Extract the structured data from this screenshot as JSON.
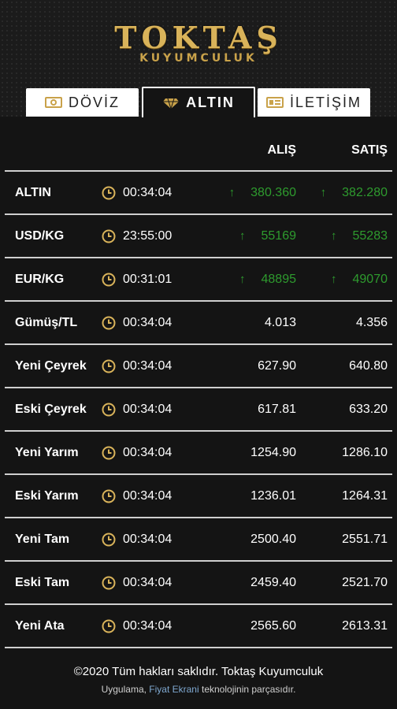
{
  "brand": {
    "name": "TOKTAŞ",
    "subtitle": "KUYUMCULUK"
  },
  "tabs": [
    {
      "label": "DÖVİZ",
      "icon": "money-icon",
      "active": false
    },
    {
      "label": "ALTIN",
      "icon": "diamond-icon",
      "active": true
    },
    {
      "label": "İLETİŞİM",
      "icon": "contact-card-icon",
      "active": false
    }
  ],
  "table": {
    "headers": {
      "buy": "ALIŞ",
      "sell": "SATIŞ"
    },
    "rows": [
      {
        "name": "ALTIN",
        "time": "00:34:04",
        "buy": "380.360",
        "sell": "382.280",
        "trend": "up"
      },
      {
        "name": "USD/KG",
        "time": "23:55:00",
        "buy": "55169",
        "sell": "55283",
        "trend": "up"
      },
      {
        "name": "EUR/KG",
        "time": "00:31:01",
        "buy": "48895",
        "sell": "49070",
        "trend": "up"
      },
      {
        "name": "Gümüş/TL",
        "time": "00:34:04",
        "buy": "4.013",
        "sell": "4.356",
        "trend": "none"
      },
      {
        "name": "Yeni Çeyrek",
        "time": "00:34:04",
        "buy": "627.90",
        "sell": "640.80",
        "trend": "none"
      },
      {
        "name": "Eski Çeyrek",
        "time": "00:34:04",
        "buy": "617.81",
        "sell": "633.20",
        "trend": "none"
      },
      {
        "name": "Yeni Yarım",
        "time": "00:34:04",
        "buy": "1254.90",
        "sell": "1286.10",
        "trend": "none"
      },
      {
        "name": "Eski Yarım",
        "time": "00:34:04",
        "buy": "1236.01",
        "sell": "1264.31",
        "trend": "none"
      },
      {
        "name": "Yeni Tam",
        "time": "00:34:04",
        "buy": "2500.40",
        "sell": "2551.71",
        "trend": "none"
      },
      {
        "name": "Eski Tam",
        "time": "00:34:04",
        "buy": "2459.40",
        "sell": "2521.70",
        "trend": "none"
      },
      {
        "name": "Yeni Ata",
        "time": "00:34:04",
        "buy": "2565.60",
        "sell": "2613.31",
        "trend": "none"
      }
    ]
  },
  "footer": {
    "copyright": "©2020 Tüm hakları saklıdır. Toktaş Kuyumculuk",
    "sub_before": "Uygulama,",
    "sub_link": "Fiyat Ekrani",
    "sub_after": "teknolojinin parçasıdır."
  },
  "colors": {
    "gold": "#d9b35a",
    "up": "#2e9b2e",
    "background": "#141414"
  },
  "icons": {
    "clock": "clock-icon",
    "arrow_up": "arrow-up-icon"
  }
}
